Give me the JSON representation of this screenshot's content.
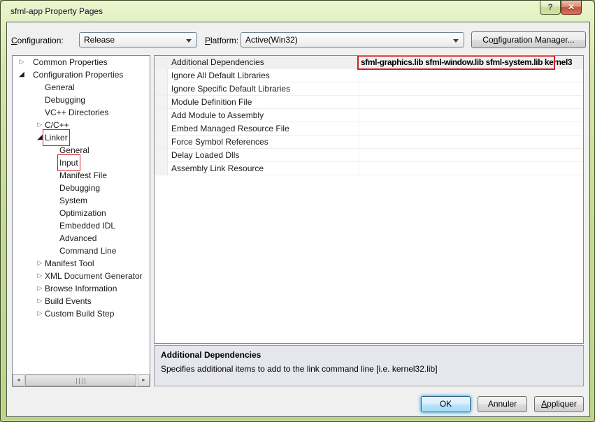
{
  "window": {
    "title": "sfml-app Property Pages",
    "help_icon": "?",
    "close_icon": "✕"
  },
  "toolbar": {
    "configuration_label": {
      "accel": "C",
      "rest": "onfiguration:"
    },
    "configuration_value": "Release",
    "platform_label": {
      "accel": "P",
      "rest": "latform:"
    },
    "platform_value": "Active(Win32)",
    "config_manager_button": {
      "pre": "Co",
      "accel": "n",
      "rest": "figuration Manager..."
    }
  },
  "icons": {
    "collapsed": "▷",
    "expanded": "◢",
    "combo_arrow": "▼",
    "scroll_left": "◄",
    "scroll_right": "►"
  },
  "tree": {
    "items": [
      {
        "label": "Common Properties",
        "level": 0,
        "state": "collapsed"
      },
      {
        "label": "Configuration Properties",
        "level": 0,
        "state": "expanded"
      },
      {
        "label": "General",
        "level": 1,
        "state": "none"
      },
      {
        "label": "Debugging",
        "level": 1,
        "state": "none"
      },
      {
        "label": "VC++ Directories",
        "level": 1,
        "state": "none"
      },
      {
        "label": "C/C++",
        "level": 1,
        "state": "collapsed"
      },
      {
        "label": "Linker",
        "level": 1,
        "state": "expanded",
        "annotated": true
      },
      {
        "label": "General",
        "level": 2,
        "state": "none"
      },
      {
        "label": "Input",
        "level": 2,
        "state": "none",
        "annotated": true
      },
      {
        "label": "Manifest File",
        "level": 2,
        "state": "none"
      },
      {
        "label": "Debugging",
        "level": 2,
        "state": "none"
      },
      {
        "label": "System",
        "level": 2,
        "state": "none"
      },
      {
        "label": "Optimization",
        "level": 2,
        "state": "none"
      },
      {
        "label": "Embedded IDL",
        "level": 2,
        "state": "none"
      },
      {
        "label": "Advanced",
        "level": 2,
        "state": "none"
      },
      {
        "label": "Command Line",
        "level": 2,
        "state": "none"
      },
      {
        "label": "Manifest Tool",
        "level": 1,
        "state": "collapsed"
      },
      {
        "label": "XML Document Generator",
        "level": 1,
        "state": "collapsed"
      },
      {
        "label": "Browse Information",
        "level": 1,
        "state": "collapsed"
      },
      {
        "label": "Build Events",
        "level": 1,
        "state": "collapsed"
      },
      {
        "label": "Custom Build Step",
        "level": 1,
        "state": "collapsed"
      }
    ]
  },
  "grid": {
    "rows": [
      {
        "name": "Additional Dependencies",
        "value": "sfml-graphics.lib sfml-window.lib sfml-system.lib kernel3",
        "selected": true,
        "annotated": true
      },
      {
        "name": "Ignore All Default Libraries",
        "value": ""
      },
      {
        "name": "Ignore Specific Default Libraries",
        "value": ""
      },
      {
        "name": "Module Definition File",
        "value": ""
      },
      {
        "name": "Add Module to Assembly",
        "value": ""
      },
      {
        "name": "Embed Managed Resource File",
        "value": ""
      },
      {
        "name": "Force Symbol References",
        "value": ""
      },
      {
        "name": "Delay Loaded Dlls",
        "value": ""
      },
      {
        "name": "Assembly Link Resource",
        "value": ""
      }
    ]
  },
  "description": {
    "title": "Additional Dependencies",
    "text": "Specifies additional items to add to the link command line [i.e. kernel32.lib]"
  },
  "footer": {
    "ok_label": "OK",
    "cancel_label": "Annuler",
    "apply_label": {
      "accel": "A",
      "rest": "ppliquer"
    }
  },
  "colors": {
    "annotation_red": "#cb2227",
    "titlebar_green": "#c3da90",
    "close_red": "#c9523c",
    "selected_row_bg": "#f0f0f0",
    "description_bg": "#e6e7ee",
    "ok_glow_blue": "#41b1e1"
  }
}
